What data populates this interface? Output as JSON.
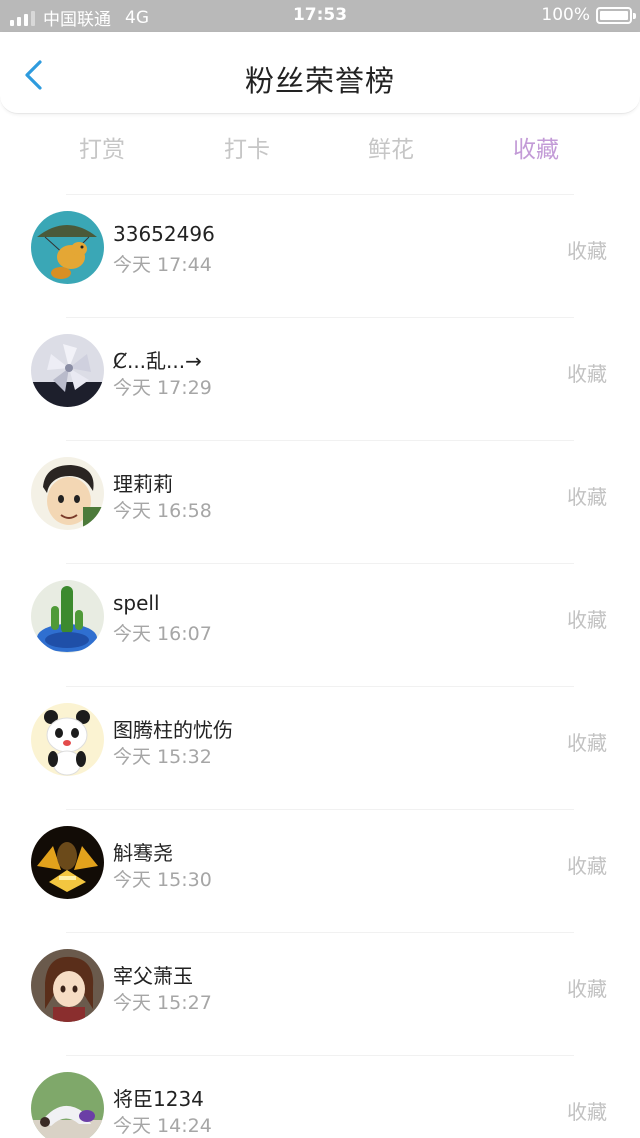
{
  "status_bar": {
    "carrier": "中国联通",
    "network": "4G",
    "time": "17:53",
    "battery": "100%",
    "signal_bars": 3
  },
  "nav": {
    "back_icon": "chevron-left-icon",
    "title": "粉丝荣誉榜"
  },
  "tabs": [
    {
      "label": "打赏",
      "active": false
    },
    {
      "label": "打卡",
      "active": false
    },
    {
      "label": "鲜花",
      "active": false
    },
    {
      "label": "收藏",
      "active": true
    }
  ],
  "colors": {
    "accent": "#c39bd7",
    "back_icon": "#2e9bde",
    "muted_text": "#a6a6a6"
  },
  "fans": [
    {
      "name": "33652496",
      "time": "今天 17:44",
      "action": "收藏",
      "avatar": "avatar-parachute-icon"
    },
    {
      "name": "Ȼ...乱...→",
      "time": "今天 17:29",
      "action": "收藏",
      "avatar": "avatar-paper-flower-icon"
    },
    {
      "name": "理莉莉",
      "time": "今天 16:58",
      "action": "收藏",
      "avatar": "avatar-cartoon-man-icon"
    },
    {
      "name": "spell",
      "time": "今天 16:07",
      "action": "收藏",
      "avatar": "avatar-cactus-icon"
    },
    {
      "name": "图腾柱的忧伤",
      "time": "今天 15:32",
      "action": "收藏",
      "avatar": "avatar-panda-icon"
    },
    {
      "name": "斛骞尧",
      "time": "今天 15:30",
      "action": "收藏",
      "avatar": "avatar-gold-armor-icon"
    },
    {
      "name": "宰父萧玉",
      "time": "今天 15:27",
      "action": "收藏",
      "avatar": "avatar-anime-girl-icon"
    },
    {
      "name": "将臣1234",
      "time": "今天 14:24",
      "action": "收藏",
      "avatar": "avatar-yoga-pose-icon"
    }
  ]
}
